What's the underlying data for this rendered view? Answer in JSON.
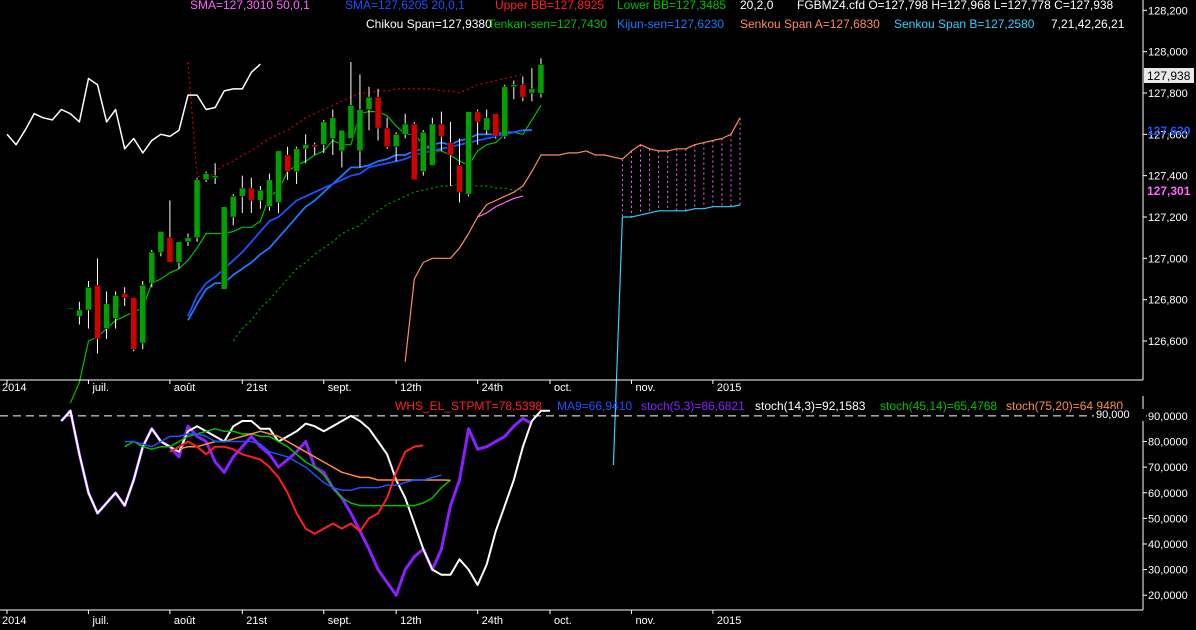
{
  "colors": {
    "background": "#000000",
    "axis": "#ffffff",
    "bull": "#00a000",
    "bear": "#d00000",
    "chikou": "#ffffff",
    "tenkan": "#00c000",
    "kijun": "#1e78ff",
    "senkou_a": "#ff8c60",
    "senkou_b": "#30d0ff",
    "sma50": "#ff66ff",
    "sma20": "#1e50ff",
    "upper_bb": "#d00000",
    "lower_bb": "#00a000",
    "whs": "#ff2020",
    "ma9": "#1e50ff",
    "stoch5": "#8a20ff",
    "stoch14": "#ffffff",
    "stoch45": "#00c000",
    "stoch75": "#ff8c40"
  },
  "legend": {
    "sma50": "SMA=127,3010  50,0,1",
    "sma20": "SMA=127,6205  20,0,1",
    "upper_bb": "Upper BB=127,8925",
    "lower_bb": "Lower BB=127,3485",
    "bb_params": "20,2,0",
    "ohlc": "FGBMZ4.cfd O=127,798 H=127,968 L=127,778 C=127,938",
    "chikou": "Chikou Span=127,9380",
    "tenkan": "Tenkan-sen=127,7430",
    "kijun": "Kijun-sen=127,6230",
    "senkou_a": "Senkou Span A=127,6830",
    "senkou_b": "Senkou Span B=127,2580",
    "ichimoku_params": "7,21,42,26,21",
    "whs": "WHS_EL_STPMT=78,5398",
    "ma9": "MA9=66,9410",
    "stoch5": "stoch(5,3)=86,6821",
    "stoch14": "stoch(14,3)=92,1583",
    "stoch45": "stoch(45,14)=65,4768",
    "stoch75": "stoch(75,20)=64,9480"
  },
  "badges": {
    "last_price": "127,938",
    "kijun": "127,620",
    "sma": "127,301",
    "upper_level": "90,000"
  },
  "chart_data": [
    {
      "type": "candlestick",
      "title": "",
      "ylim": [
        126.45,
        128.25
      ],
      "y_ticks": [
        "128,200",
        "128,000",
        "127,800",
        "127,600",
        "127,400",
        "127,200",
        "127,000",
        "126,800",
        "126,600"
      ],
      "y_tick_values": [
        128.2,
        128.0,
        127.8,
        127.6,
        127.4,
        127.2,
        127.0,
        126.8,
        126.6
      ],
      "x_ticks": [
        "2014",
        "juil.",
        "août",
        "21st",
        "sept.",
        "12th",
        "24th",
        "oct.",
        "nov.",
        "2015"
      ],
      "x_tick_index": [
        0,
        9,
        18,
        26,
        35,
        43,
        52,
        60,
        69,
        78
      ],
      "n_slots": 80,
      "candles_start": 7,
      "candles": [
        [
          126.76,
          126.76,
          126.76,
          126.76
        ],
        [
          126.72,
          126.79,
          126.68,
          126.75
        ],
        [
          126.75,
          126.89,
          126.66,
          126.86
        ],
        [
          126.87,
          127.0,
          126.54,
          126.61
        ],
        [
          126.66,
          126.84,
          126.61,
          126.78
        ],
        [
          126.71,
          126.84,
          126.66,
          126.82
        ],
        [
          126.83,
          126.86,
          126.77,
          126.81
        ],
        [
          126.81,
          126.81,
          126.55,
          126.56
        ],
        [
          126.59,
          126.89,
          126.56,
          126.87
        ],
        [
          126.88,
          127.04,
          126.86,
          127.03
        ],
        [
          127.03,
          127.13,
          127.01,
          127.13
        ],
        [
          127.1,
          127.28,
          127.04,
          126.98
        ],
        [
          126.98,
          127.08,
          126.95,
          127.08
        ],
        [
          127.08,
          127.12,
          127.06,
          127.1
        ],
        [
          127.1,
          127.39,
          127.08,
          127.38
        ],
        [
          127.38,
          127.42,
          127.37,
          127.41
        ],
        [
          127.39,
          127.46,
          127.36,
          127.4
        ],
        [
          126.85,
          127.25,
          126.85,
          127.25
        ],
        [
          127.2,
          127.31,
          127.16,
          127.3
        ],
        [
          127.3,
          127.4,
          127.22,
          127.34
        ],
        [
          127.34,
          127.39,
          127.22,
          127.28
        ],
        [
          127.28,
          127.35,
          127.24,
          127.33
        ],
        [
          127.25,
          127.41,
          127.23,
          127.38
        ],
        [
          127.27,
          127.52,
          127.22,
          127.52
        ],
        [
          127.5,
          127.54,
          127.38,
          127.42
        ],
        [
          127.42,
          127.54,
          127.36,
          127.53
        ],
        [
          127.53,
          127.6,
          127.46,
          127.55
        ],
        [
          127.55,
          127.56,
          127.5,
          127.54
        ],
        [
          127.55,
          127.67,
          127.51,
          127.66
        ],
        [
          127.58,
          127.72,
          127.5,
          127.68
        ],
        [
          127.52,
          127.62,
          127.44,
          127.62
        ],
        [
          127.58,
          127.95,
          127.58,
          127.74
        ],
        [
          127.52,
          127.89,
          127.44,
          127.72
        ],
        [
          127.72,
          127.83,
          127.62,
          127.78
        ],
        [
          127.78,
          127.82,
          127.57,
          127.63
        ],
        [
          127.63,
          127.68,
          127.53,
          127.54
        ],
        [
          127.54,
          127.61,
          127.47,
          127.6
        ],
        [
          127.6,
          127.7,
          127.58,
          127.65
        ],
        [
          127.65,
          127.66,
          127.38,
          127.38
        ],
        [
          127.42,
          127.62,
          127.4,
          127.61
        ],
        [
          127.45,
          127.68,
          127.45,
          127.65
        ],
        [
          127.65,
          127.71,
          127.52,
          127.59
        ],
        [
          127.56,
          127.66,
          127.35,
          127.5
        ],
        [
          127.45,
          127.58,
          127.27,
          127.32
        ],
        [
          127.31,
          127.71,
          127.3,
          127.71
        ],
        [
          127.71,
          127.72,
          127.55,
          127.66
        ],
        [
          127.62,
          127.72,
          127.6,
          127.68
        ],
        [
          127.7,
          127.7,
          127.58,
          127.59
        ],
        [
          127.59,
          127.84,
          127.58,
          127.83
        ],
        [
          127.83,
          127.86,
          127.77,
          127.84
        ],
        [
          127.84,
          127.88,
          127.76,
          127.78
        ],
        [
          127.8,
          127.92,
          127.76,
          127.82
        ],
        [
          127.798,
          127.968,
          127.778,
          127.938
        ]
      ],
      "series": [
        {
          "name": "Chikou Span",
          "key": "chikou",
          "start": 0,
          "values": [
            127.6,
            127.55,
            127.62,
            127.7,
            127.68,
            127.67,
            127.72,
            127.7,
            127.66,
            127.87,
            127.84,
            127.66,
            127.72,
            127.53,
            127.58,
            127.51,
            127.57,
            127.6,
            127.59,
            127.62,
            127.79,
            127.79,
            127.72,
            127.73,
            127.81,
            127.82,
            127.82,
            127.9,
            127.94
          ]
        },
        {
          "name": "Tenkan-sen",
          "key": "tenkan",
          "start": 7,
          "values": [
            126.3,
            126.4,
            126.6,
            126.62,
            126.66,
            126.7,
            126.72,
            126.74,
            126.76,
            126.88,
            126.9,
            126.93,
            126.95,
            126.99,
            127.05,
            127.12,
            127.12,
            127.12,
            127.13,
            127.15,
            127.15,
            127.18,
            127.3,
            127.33,
            127.42,
            127.45,
            127.47,
            127.5,
            127.52,
            127.57,
            127.55,
            127.55,
            127.7,
            127.71,
            127.71,
            127.69,
            127.64,
            127.6,
            127.6,
            127.55,
            127.52,
            127.52,
            127.5,
            127.47,
            127.45,
            127.52,
            127.55,
            127.56,
            127.6,
            127.61,
            127.6,
            127.67,
            127.74
          ]
        },
        {
          "name": "Kijun-sen",
          "key": "kijun",
          "start": 20,
          "values": [
            126.7,
            126.78,
            126.85,
            126.88,
            126.88,
            126.92,
            126.95,
            126.98,
            127.02,
            127.05,
            127.1,
            127.15,
            127.2,
            127.25,
            127.28,
            127.32,
            127.36,
            127.4,
            127.44,
            127.44,
            127.45,
            127.47,
            127.48,
            127.5,
            127.5,
            127.52,
            127.53,
            127.55,
            127.56,
            127.55,
            127.57,
            127.58,
            127.6,
            127.6,
            127.6,
            127.61,
            127.61,
            127.62,
            127.62
          ]
        },
        {
          "name": "Senkou Span A",
          "key": "senkou_a",
          "start": 44,
          "values": [
            126.5,
            126.9,
            126.98,
            127.0,
            127.0,
            127.0,
            127.05,
            127.12,
            127.2,
            127.26,
            127.28,
            127.3,
            127.32,
            127.35,
            127.42,
            127.5,
            127.5,
            127.5,
            127.51,
            127.51,
            127.52,
            127.5,
            127.5,
            127.49,
            127.48,
            127.52,
            127.55,
            127.53,
            127.52,
            127.52,
            127.53,
            127.53,
            127.55,
            127.56,
            127.57,
            127.58,
            127.6,
            127.68
          ]
        },
        {
          "name": "Senkou Span B",
          "key": "senkou_b",
          "start": 67,
          "values": [
            126.0,
            127.2,
            127.2,
            127.21,
            127.22,
            127.23,
            127.23,
            127.23,
            127.23,
            127.24,
            127.24,
            127.25,
            127.25,
            127.25,
            127.258
          ]
        },
        {
          "name": "SMA 50",
          "key": "sma50",
          "start": 52,
          "values": [
            127.2,
            127.22,
            127.25,
            127.27,
            127.29,
            127.301
          ]
        },
        {
          "name": "SMA 20",
          "key": "sma20",
          "start": 20,
          "values": [
            126.72,
            126.82,
            126.88,
            126.91,
            126.95,
            126.99,
            127.03,
            127.08,
            127.13,
            127.18,
            127.2,
            127.24,
            127.28,
            127.3,
            127.32,
            127.34,
            127.36,
            127.38,
            127.4,
            127.41,
            127.44,
            127.45,
            127.46,
            127.47,
            127.48,
            127.5,
            127.51,
            127.52,
            127.53,
            127.54,
            127.55,
            127.56,
            127.57,
            127.58,
            127.59,
            127.6,
            127.61,
            127.62
          ]
        },
        {
          "name": "Upper BB",
          "key": "upper_bb",
          "start": 20,
          "values": [
            127.95,
            127.4,
            127.38,
            127.42,
            127.45,
            127.47,
            127.5,
            127.52,
            127.55,
            127.58,
            127.6,
            127.62,
            127.65,
            127.68,
            127.7,
            127.72,
            127.74,
            127.76,
            127.78,
            127.8,
            127.8,
            127.81,
            127.81,
            127.82,
            127.82,
            127.82,
            127.82,
            127.82,
            127.81,
            127.81,
            127.8,
            127.82,
            127.84,
            127.85,
            127.86,
            127.87,
            127.88,
            127.89
          ]
        },
        {
          "name": "Lower BB",
          "key": "lower_bb",
          "start": 25,
          "values": [
            126.6,
            126.66,
            126.7,
            126.76,
            126.8,
            126.85,
            126.9,
            126.95,
            126.98,
            127.02,
            127.05,
            127.08,
            127.12,
            127.14,
            127.16,
            127.2,
            127.23,
            127.26,
            127.28,
            127.3,
            127.32,
            127.33,
            127.34,
            127.35,
            127.35,
            127.36,
            127.36,
            127.35,
            127.35,
            127.34,
            127.34,
            127.33,
            127.33
          ]
        }
      ]
    },
    {
      "type": "line",
      "title": "",
      "ylim": [
        15,
        97
      ],
      "y_ticks": [
        "90,0000",
        "80,0000",
        "70,0000",
        "60,0000",
        "50,0000",
        "40,0000",
        "30,0000",
        "20,0000"
      ],
      "y_tick_values": [
        90,
        80,
        70,
        60,
        50,
        40,
        30,
        20
      ],
      "reference_line": 90,
      "x_ticks": [
        "2014",
        "juil.",
        "août",
        "21st",
        "sept.",
        "12th",
        "24th",
        "oct.",
        "nov.",
        "2015"
      ],
      "series": [
        {
          "name": "stoch(5,3)",
          "key": "stoch5",
          "start": 6,
          "width": 3,
          "values": [
            88,
            92,
            75,
            60,
            52,
            56,
            60,
            55,
            65,
            78,
            85,
            80,
            78,
            74,
            86,
            82,
            80,
            72,
            68,
            74,
            78,
            82,
            78,
            75,
            70,
            73,
            76,
            80,
            70,
            68,
            62,
            58,
            52,
            45,
            38,
            30,
            25,
            20,
            30,
            35,
            38,
            30,
            38,
            55,
            65,
            85,
            77,
            78,
            80,
            82,
            86,
            89,
            87
          ]
        },
        {
          "name": "stoch(14,3)",
          "key": "stoch14",
          "start": 6,
          "width": 2,
          "values": [
            88,
            92,
            75,
            60,
            52,
            56,
            60,
            55,
            65,
            78,
            85,
            80,
            78,
            76,
            84,
            86,
            84,
            82,
            80,
            86,
            88,
            88,
            85,
            85,
            80,
            82,
            84,
            87,
            86,
            84,
            86,
            88,
            90,
            88,
            85,
            80,
            75,
            65,
            58,
            48,
            38,
            30,
            28,
            28,
            34,
            30,
            24,
            32,
            45,
            55,
            65,
            78,
            88,
            92,
            92
          ]
        },
        {
          "name": "stoch(45,14)",
          "key": "stoch45",
          "start": 13,
          "width": 1.5,
          "values": [
            78,
            80,
            78,
            77,
            78,
            78,
            80,
            82,
            83,
            84,
            85,
            84,
            84,
            83,
            83,
            82,
            82,
            80,
            78,
            75,
            72,
            70,
            67,
            62,
            58,
            56,
            55,
            55,
            55,
            55,
            55,
            55,
            55,
            56,
            58,
            62,
            65
          ]
        },
        {
          "name": "stoch(75,20)",
          "key": "stoch75",
          "start": 19,
          "width": 1.5,
          "values": [
            77,
            78,
            78,
            79,
            80,
            80,
            81,
            82,
            83,
            84,
            83,
            82,
            80,
            78,
            76,
            74,
            72,
            70,
            68,
            67,
            66,
            66,
            65,
            65,
            65,
            65,
            65,
            65,
            65,
            65,
            64.9
          ]
        },
        {
          "name": "MA9",
          "key": "ma9",
          "start": 13,
          "width": 1.5,
          "values": [
            80,
            80,
            79,
            78,
            80,
            82,
            82,
            83,
            83,
            82,
            80,
            80,
            80,
            80,
            80,
            79,
            76,
            75,
            74,
            72,
            70,
            67,
            64,
            62,
            61,
            61,
            62,
            62,
            62,
            63,
            63,
            64,
            65,
            65,
            66,
            66.9
          ]
        },
        {
          "name": "WHS_EL_STPMT",
          "key": "whs",
          "start": 18,
          "width": 2,
          "values": [
            76,
            78,
            80,
            78,
            75,
            78,
            78,
            77,
            75,
            74,
            73,
            70,
            66,
            60,
            52,
            46,
            44,
            46,
            48,
            46,
            48,
            45,
            50,
            52,
            58,
            68,
            76,
            78,
            78.5
          ]
        }
      ]
    }
  ]
}
